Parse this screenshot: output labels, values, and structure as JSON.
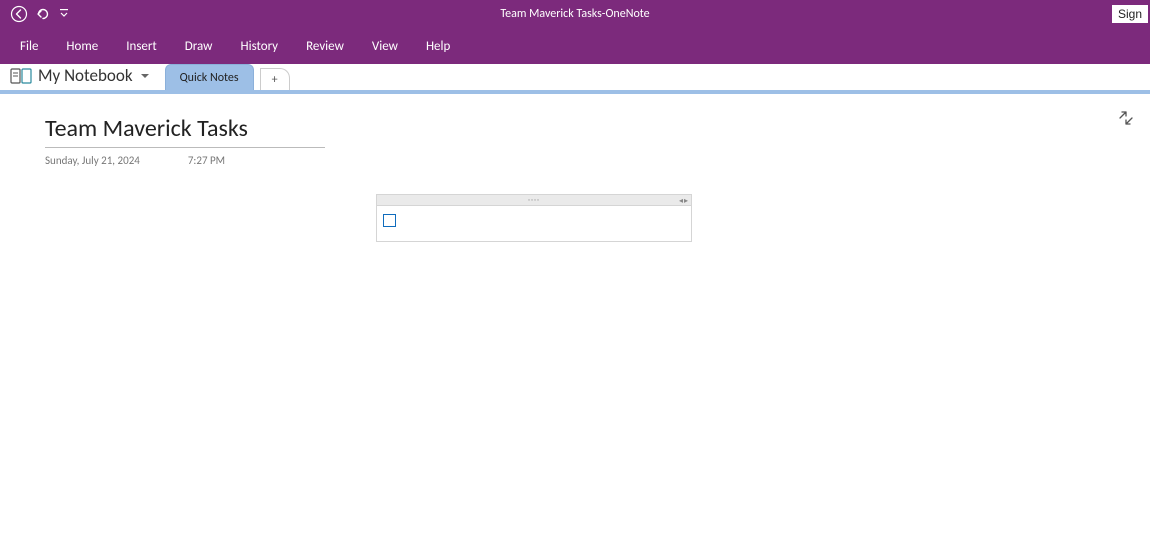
{
  "app": {
    "title_doc": "Team Maverick Tasks",
    "title_sep": "  -  ",
    "title_app": "OneNote",
    "sign_in": "Sign"
  },
  "menu": {
    "items": [
      "File",
      "Home",
      "Insert",
      "Draw",
      "History",
      "Review",
      "View",
      "Help"
    ]
  },
  "notebook": {
    "name": "My Notebook"
  },
  "tabs": {
    "sections": [
      "Quick Notes"
    ],
    "add_label": "+"
  },
  "page": {
    "title": "Team Maverick Tasks",
    "date": "Sunday, July 21, 2024",
    "time": "7:27 PM"
  }
}
